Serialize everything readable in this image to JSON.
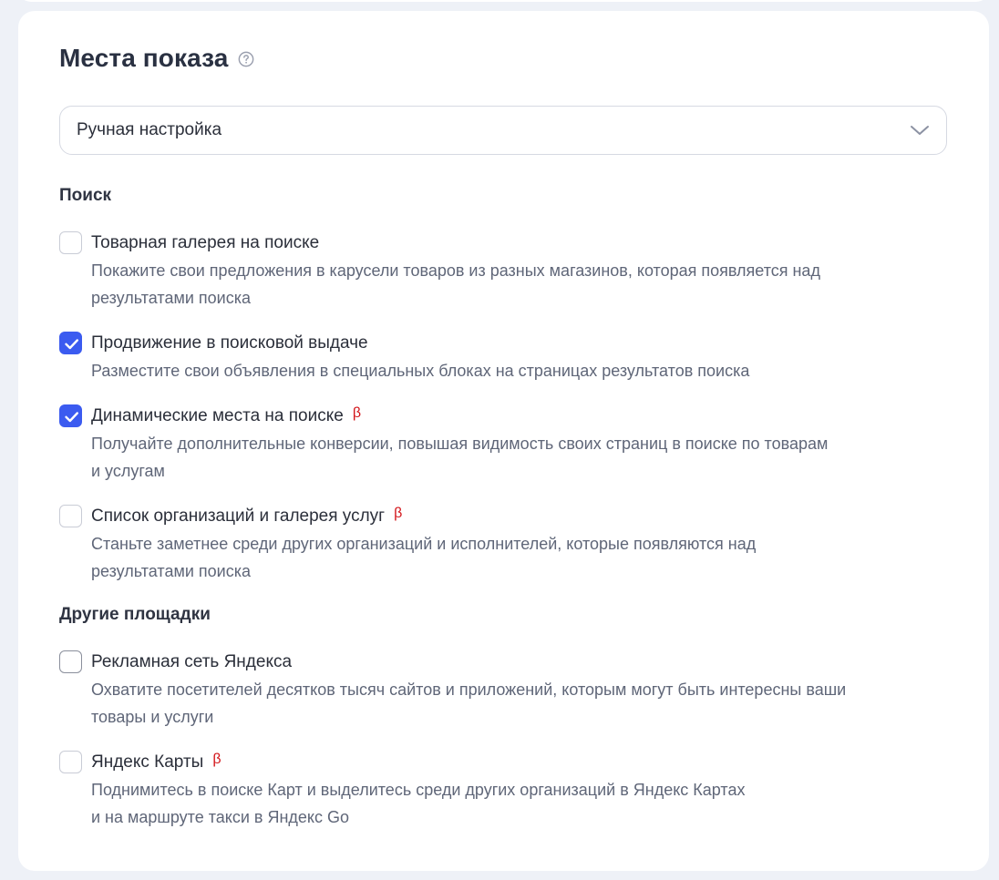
{
  "panel": {
    "title": "Места показа",
    "help_icon": "question-circle-icon"
  },
  "placement_select": {
    "value": "Ручная настройка",
    "icon": "chevron-down-icon"
  },
  "sections": {
    "search": {
      "title": "Поиск",
      "options": [
        {
          "title": "Товарная галерея на поиске",
          "checked": false,
          "beta": "",
          "desc_line1": "Покажите свои предложения в карусели товаров из разных магазинов, которая появляется над",
          "desc_line2": "результатами поиска"
        },
        {
          "title": "Продвижение в поисковой выдаче",
          "checked": true,
          "beta": "",
          "desc_line1": "Разместите свои объявления в специальных блоках на страницах результатов поиска",
          "desc_line2": ""
        },
        {
          "title": "Динамические места на поиске",
          "checked": true,
          "beta": "β",
          "desc_line1": "Получайте дополнительные конверсии, повышая видимость своих страниц в поиске по товарам",
          "desc_line2": "и услугам"
        },
        {
          "title": "Список организаций и галерея услуг",
          "checked": false,
          "beta": "β",
          "desc_line1": "Станьте заметнее среди других организаций и исполнителей, которые появляются над",
          "desc_line2": "результатами поиска"
        }
      ]
    },
    "other": {
      "title": "Другие площадки",
      "options": [
        {
          "title": "Рекламная сеть Яндекса",
          "checked": false,
          "beta": "",
          "desc_line1": "Охватите посетителей десятков тысяч сайтов и приложений, которым могут быть интересны ваши",
          "desc_line2": "товары и услуги"
        },
        {
          "title": "Яндекс Карты",
          "checked": false,
          "beta": "β",
          "desc_line1": "Поднимитесь в поиске Карт и выделитесь среди других организаций в Яндекс Картах",
          "desc_line2": "и на маршруте такси в Яндекс Go"
        }
      ]
    }
  },
  "colors": {
    "accent": "#3b5bf0",
    "beta": "#d3151a",
    "page_bg": "#eef1f7"
  }
}
